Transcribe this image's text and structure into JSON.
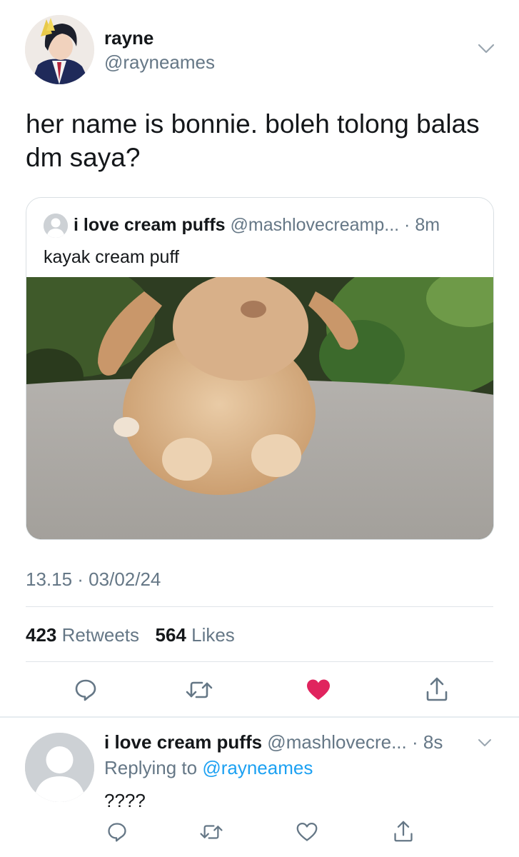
{
  "main_tweet": {
    "display_name": "rayne",
    "handle": "@rayneames",
    "text": "her name is bonnie. boleh tolong balas dm saya?",
    "quoted": {
      "display_name": "i love cream puffs",
      "handle_time": " @mashlovecreamp... · 8m",
      "text": "kayak cream puff"
    },
    "timestamp": "13.15 · 03/02/24",
    "retweets_count": "423",
    "retweets_label": "Retweets",
    "likes_count": "564",
    "likes_label": "Likes",
    "liked": true,
    "like_color": "#e0245e"
  },
  "reply_tweet": {
    "display_name": "i love cream puffs",
    "handle_time": " @mashlovecre... · 8s",
    "replying_prefix": "Replying to ",
    "replying_handle": "@rayneames",
    "text": "????"
  },
  "colors": {
    "text_primary": "#14171a",
    "text_secondary": "#657786",
    "link": "#1da1f2",
    "divider": "#dfe4e8"
  },
  "icons": [
    "reply-icon",
    "retweet-icon",
    "like-icon",
    "share-icon",
    "chevron-down-icon"
  ]
}
